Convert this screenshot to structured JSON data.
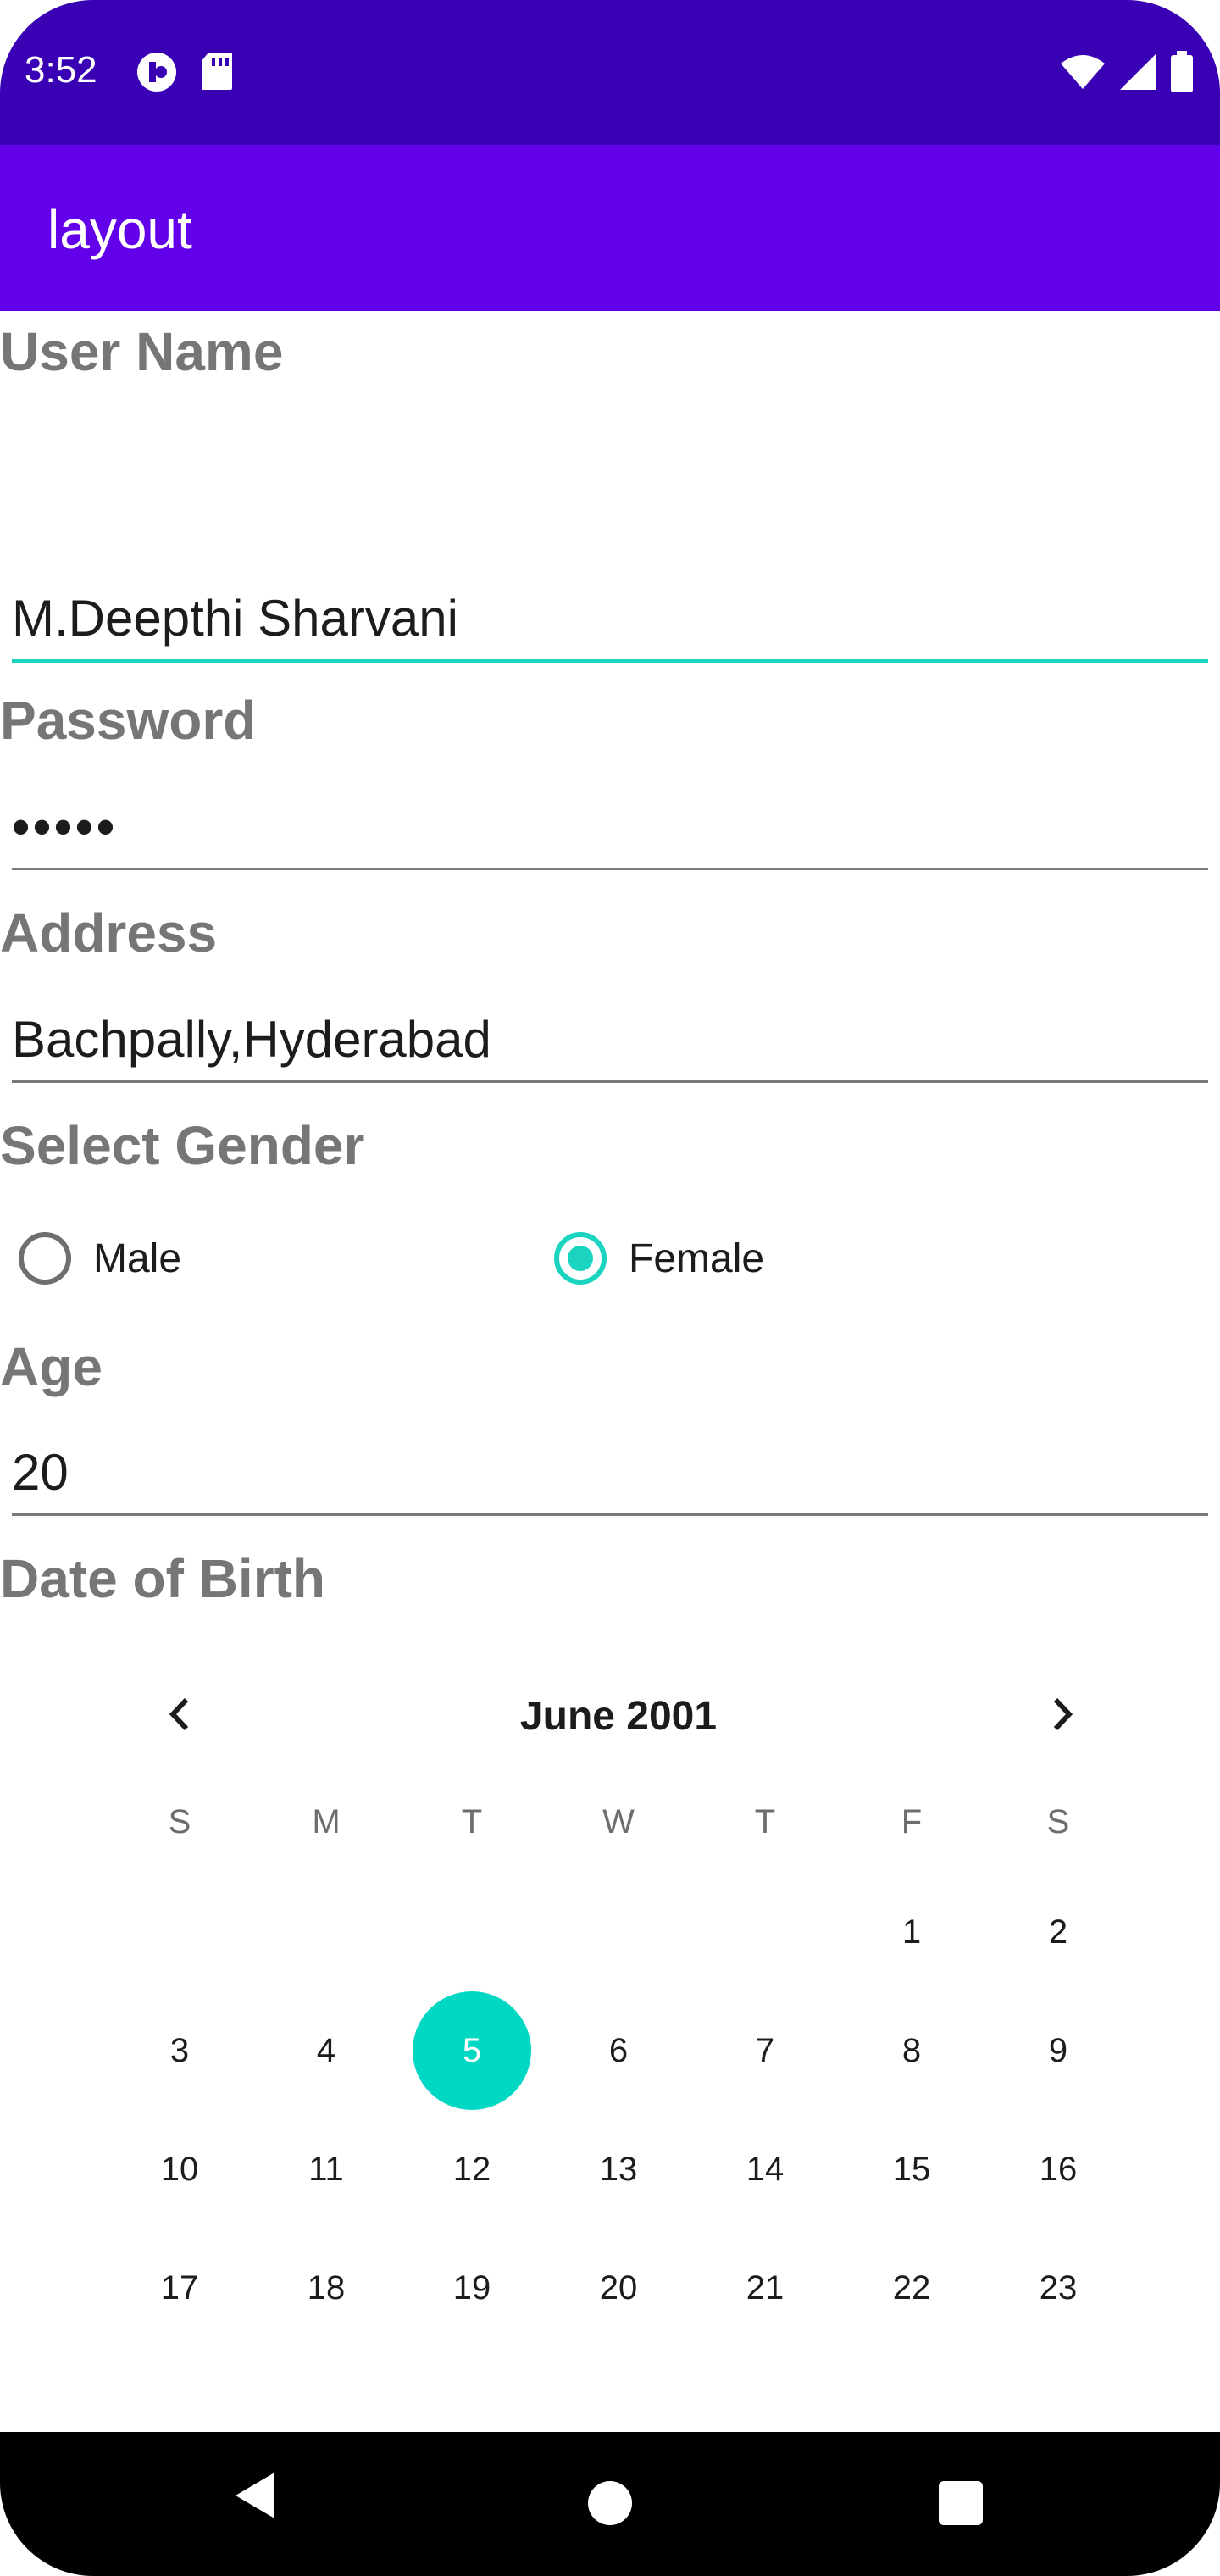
{
  "status_bar": {
    "time": "3:52",
    "icons_left": [
      "circle-logo-icon",
      "sd-card-icon"
    ],
    "icons_right": [
      "wifi-icon",
      "signal-icon",
      "battery-icon"
    ]
  },
  "app_bar": {
    "title": "layout"
  },
  "form": {
    "username": {
      "label": "User Name",
      "value": "M.Deepthi Sharvani"
    },
    "password": {
      "label": "Password",
      "value": "•••••"
    },
    "address": {
      "label": "Address",
      "value": "Bachpally,Hyderabad"
    },
    "gender": {
      "label": "Select Gender",
      "options": [
        {
          "label": "Male",
          "selected": false
        },
        {
          "label": "Female",
          "selected": true
        }
      ]
    },
    "age": {
      "label": "Age",
      "value": "20"
    },
    "dob": {
      "label": "Date of Birth"
    }
  },
  "calendar": {
    "month_label": "June 2001",
    "weekdays": [
      "S",
      "M",
      "T",
      "W",
      "T",
      "F",
      "S"
    ],
    "weeks": [
      [
        "",
        "",
        "",
        "",
        "",
        "1",
        "2"
      ],
      [
        "3",
        "4",
        "5",
        "6",
        "7",
        "8",
        "9"
      ],
      [
        "10",
        "11",
        "12",
        "13",
        "14",
        "15",
        "16"
      ],
      [
        "17",
        "18",
        "19",
        "20",
        "21",
        "22",
        "23"
      ]
    ],
    "selected_day": "5",
    "accent_color": "#00d8c4"
  },
  "colors": {
    "status_bar": "#3a00b4",
    "app_bar": "#6200ea",
    "accent": "#1ad4c0",
    "label": "#767676"
  },
  "nav_bar": {
    "icons": [
      "back-icon",
      "home-icon",
      "recents-icon"
    ]
  }
}
